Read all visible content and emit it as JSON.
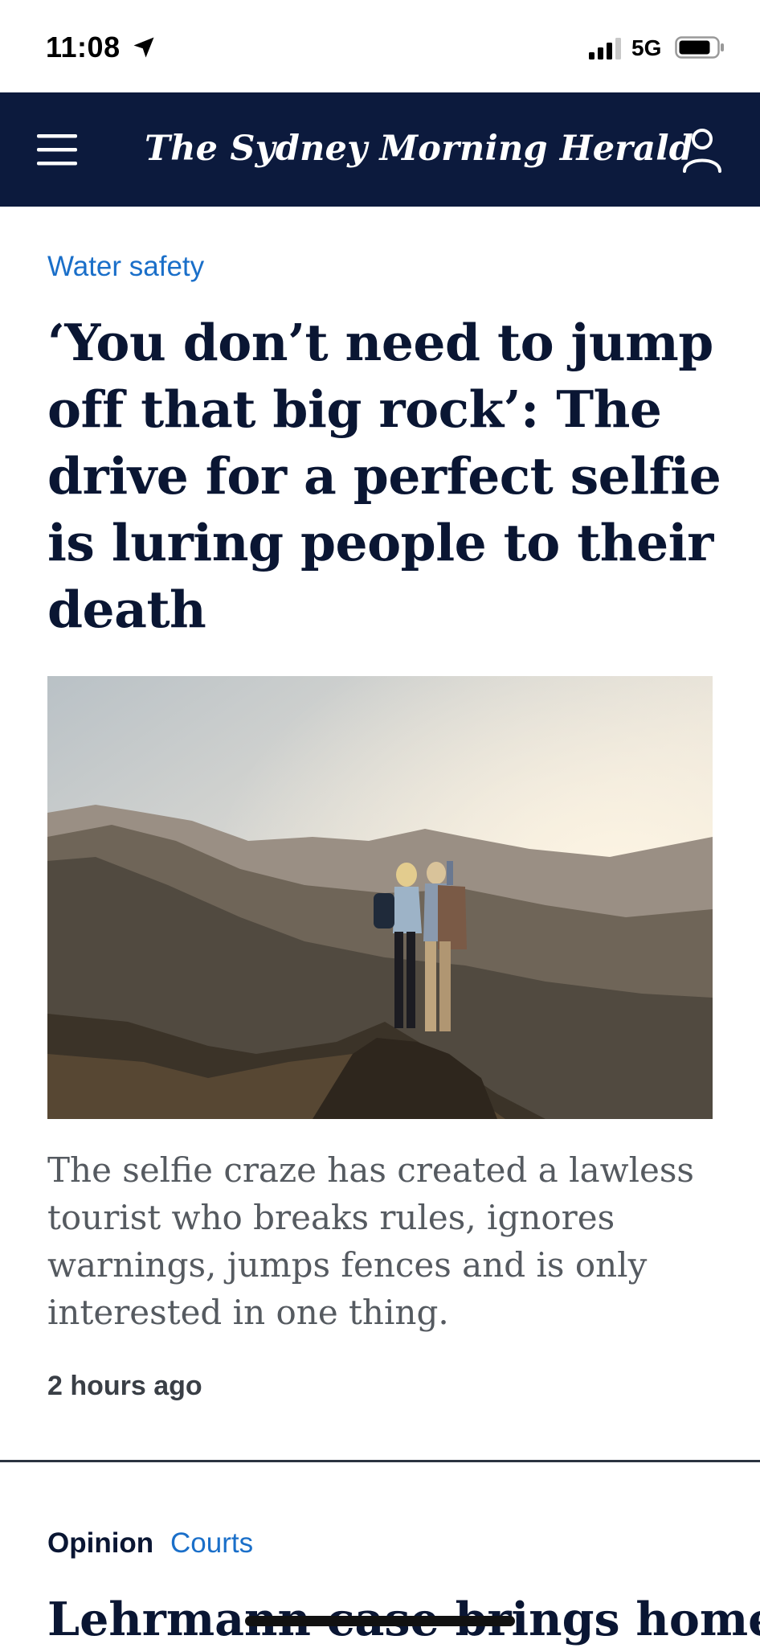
{
  "status_bar": {
    "time": "11:08",
    "network": "5G",
    "icons": [
      "location-arrow-icon",
      "cellular-signal-icon",
      "battery-icon"
    ]
  },
  "header": {
    "masthead": "The Sydney Morning Herald",
    "background_color": "#0c1a3d",
    "icons": [
      "hamburger-menu-icon",
      "user-account-icon"
    ]
  },
  "articles": [
    {
      "section": "Water safety",
      "headline": "‘You don’t need to jump off that big rock’: The drive for a perfect selfie is luring people to their death",
      "summary": "The selfie craze has created a lawless tourist who breaks rules, ignores warnings, jumps fences and is only interested in one thing.",
      "timestamp": "2 hours ago"
    },
    {
      "label": "Opinion",
      "section": "Courts",
      "headline": "Lehrmann case brings home"
    }
  ],
  "colors": {
    "section_link": "#1a6fc9",
    "headline_text": "#0a1633",
    "summary_text": "#555a60"
  }
}
